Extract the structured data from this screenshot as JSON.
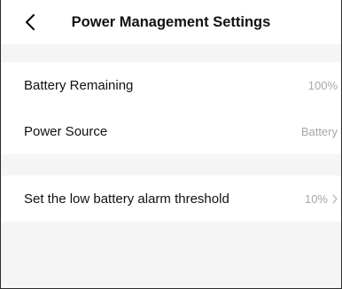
{
  "header": {
    "title": "Power Management Settings"
  },
  "icons": {
    "back": "chevron-left-icon",
    "row_arrow": "chevron-right-icon"
  },
  "group1": [
    {
      "label": "Battery Remaining",
      "value": "100%"
    },
    {
      "label": "Power Source",
      "value": "Battery"
    }
  ],
  "group2": [
    {
      "label": "Set the low battery alarm threshold",
      "value": "10%"
    }
  ],
  "colors": {
    "background": "#f5f5f5",
    "card": "#ffffff",
    "text": "#111111",
    "secondary_text": "#a8a8a8"
  }
}
